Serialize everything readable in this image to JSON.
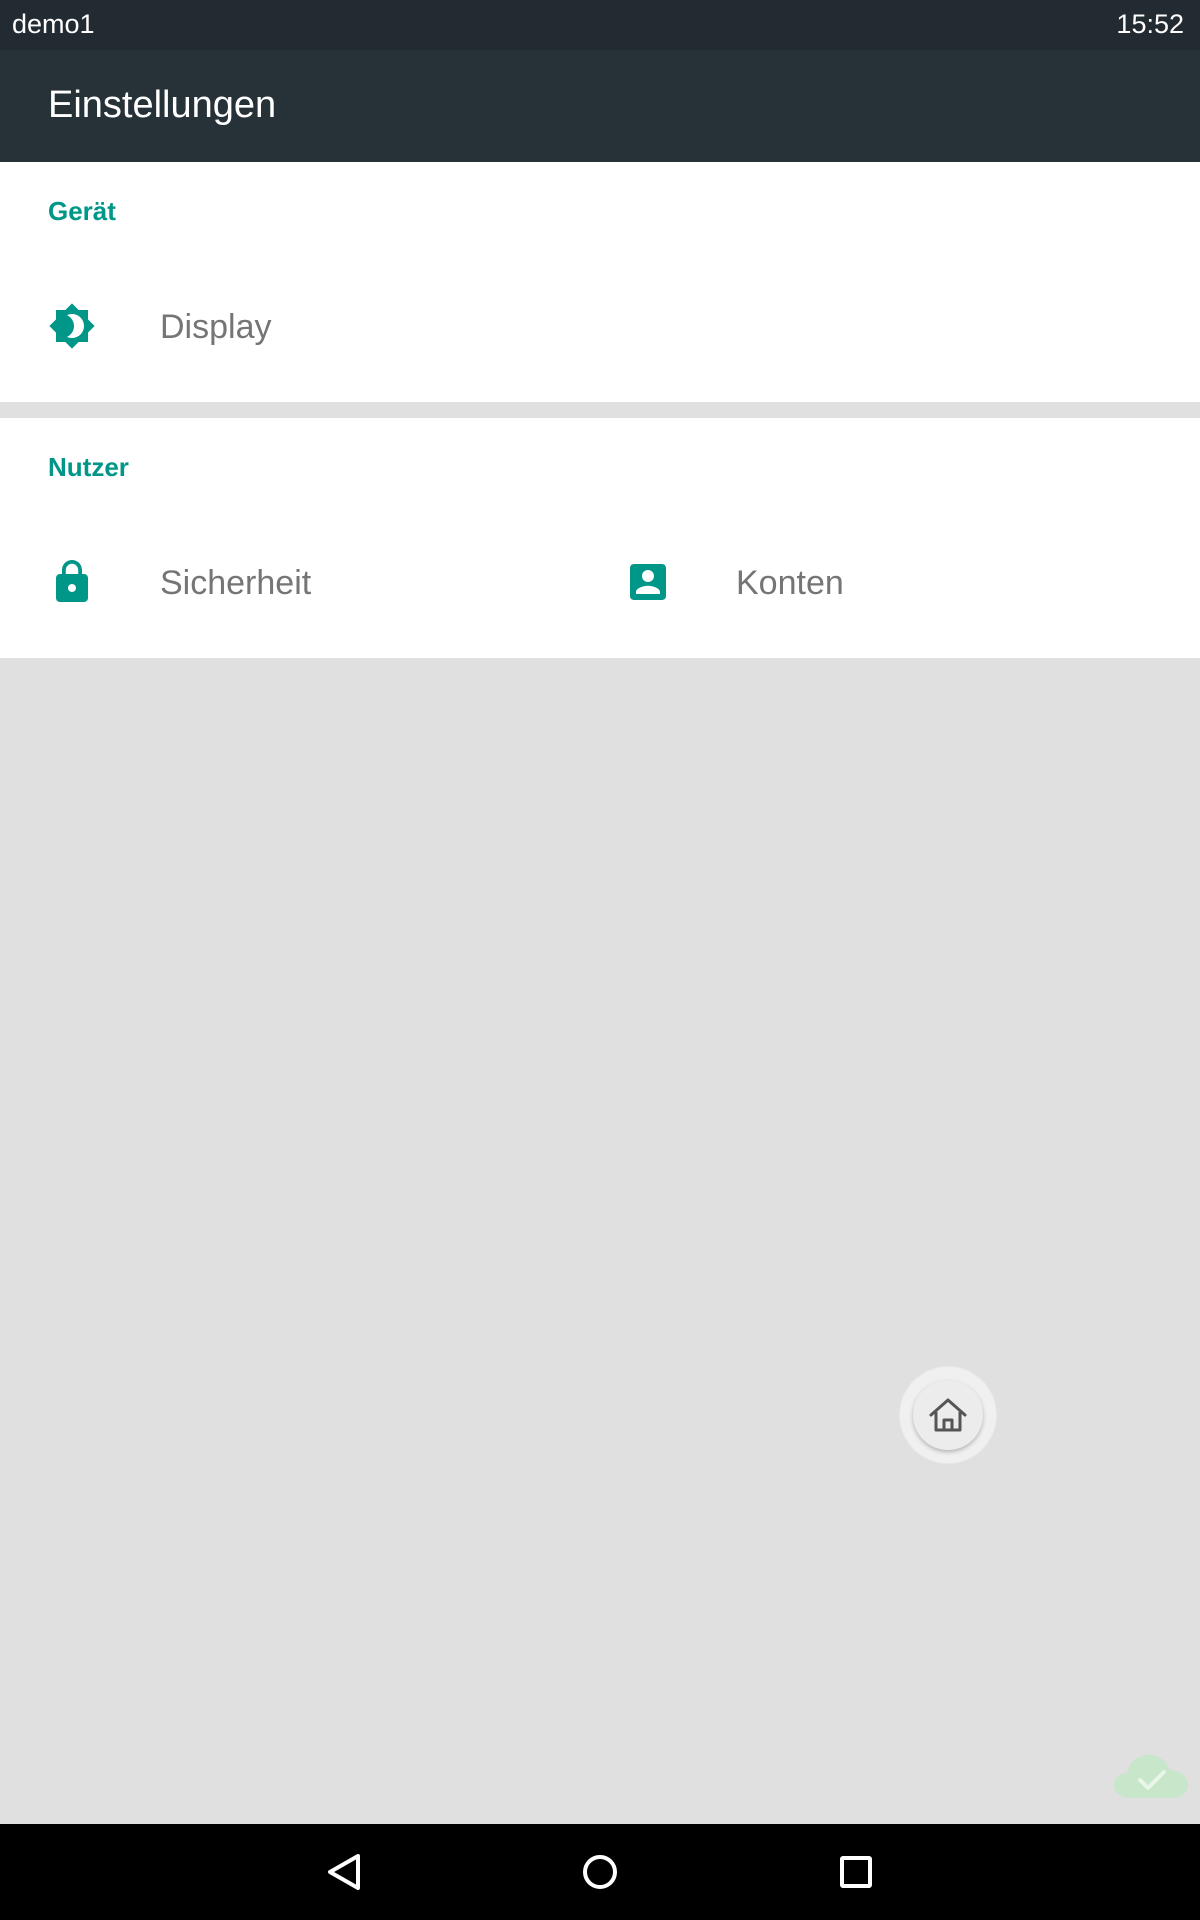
{
  "status_bar": {
    "device_name": "demo1",
    "time": "15:52"
  },
  "app_bar": {
    "title": "Einstellungen"
  },
  "sections": [
    {
      "header": "Gerät",
      "tiles": [
        {
          "label": "Display",
          "icon": "brightness-icon"
        }
      ]
    },
    {
      "header": "Nutzer",
      "tiles": [
        {
          "label": "Sicherheit",
          "icon": "lock-icon"
        },
        {
          "label": "Konten",
          "icon": "account-box-icon"
        }
      ]
    }
  ],
  "colors": {
    "status_bar": "#222b31",
    "app_bar": "#263238",
    "accent": "#009688",
    "label_text": "#757575",
    "background": "#e0e0e0",
    "nav_bar": "#000000"
  },
  "floating": {
    "home_button_icon": "home-icon",
    "sync_status_icon": "cloud-check-icon"
  },
  "nav_bar": {
    "buttons": [
      "back-icon",
      "home-circle-icon",
      "recents-icon"
    ]
  }
}
